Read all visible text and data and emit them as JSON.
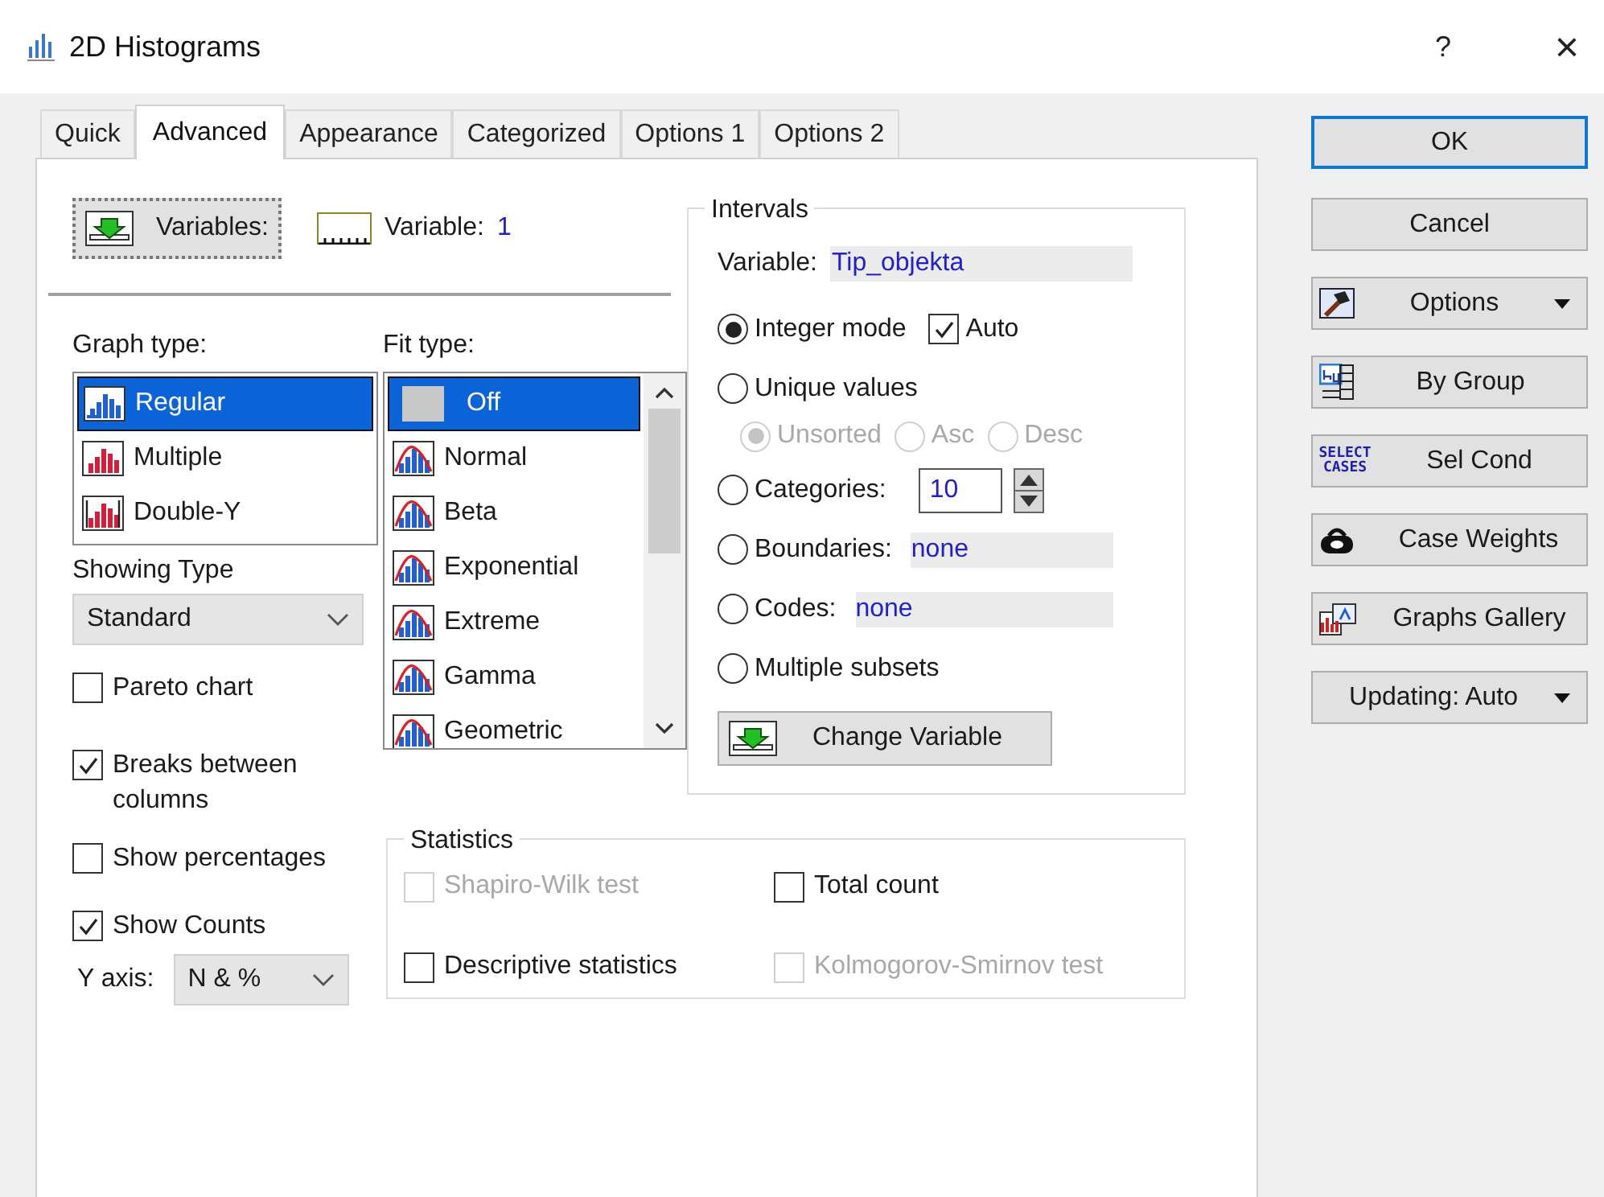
{
  "window": {
    "title": "2D Histograms",
    "help": "?",
    "close": "×"
  },
  "tabs": [
    {
      "label": "Quick",
      "selected": false
    },
    {
      "label": "Advanced",
      "selected": true
    },
    {
      "label": "Appearance",
      "selected": false
    },
    {
      "label": "Categorized",
      "selected": false
    },
    {
      "label": "Options 1",
      "selected": false
    },
    {
      "label": "Options 2",
      "selected": false
    }
  ],
  "variables_button": {
    "label": "Variables:"
  },
  "variable_summary": {
    "label": "Variable:",
    "value": "1"
  },
  "graph_type": {
    "label": "Graph type:",
    "items": [
      {
        "label": "Regular",
        "selected": true
      },
      {
        "label": "Multiple",
        "selected": false
      },
      {
        "label": "Double-Y",
        "selected": false
      }
    ]
  },
  "fit_type": {
    "label": "Fit type:",
    "items": [
      {
        "label": "Off",
        "selected": true
      },
      {
        "label": "Normal",
        "selected": false
      },
      {
        "label": "Beta",
        "selected": false
      },
      {
        "label": "Exponential",
        "selected": false
      },
      {
        "label": "Extreme",
        "selected": false
      },
      {
        "label": "Gamma",
        "selected": false
      },
      {
        "label": "Geometric",
        "selected": false
      }
    ]
  },
  "showing_type": {
    "label": "Showing Type",
    "value": "Standard"
  },
  "options": [
    {
      "label": "Pareto chart",
      "checked": false
    },
    {
      "label": "Breaks between columns",
      "checked": true
    },
    {
      "label": "Show percentages",
      "checked": false
    },
    {
      "label": "Show Counts",
      "checked": true
    }
  ],
  "y_axis": {
    "label": "Y axis:",
    "value": "N & %"
  },
  "intervals": {
    "title": "Intervals",
    "variable_label": "Variable:",
    "variable_value": "Tip_objekta",
    "modes": [
      {
        "kind": "integer",
        "label": "Integer mode",
        "selected": true,
        "auto": {
          "label": "Auto",
          "checked": true
        }
      },
      {
        "kind": "unique",
        "label": "Unique values",
        "selected": false,
        "sort": [
          {
            "label": "Unsorted",
            "selected": true
          },
          {
            "label": "Asc",
            "selected": false
          },
          {
            "label": "Desc",
            "selected": false
          }
        ]
      },
      {
        "kind": "spinner",
        "label": "Categories:",
        "selected": false,
        "value": "10"
      },
      {
        "kind": "field",
        "label": "Boundaries:",
        "selected": false,
        "value": "none"
      },
      {
        "kind": "field",
        "label": "Codes:",
        "selected": false,
        "value": "none"
      },
      {
        "kind": "plain",
        "label": "Multiple subsets",
        "selected": false
      }
    ],
    "change_button": "Change Variable"
  },
  "statistics": {
    "title": "Statistics",
    "items": [
      {
        "label": "Shapiro-Wilk test",
        "checked": false,
        "disabled": true
      },
      {
        "label": "Total count",
        "checked": false,
        "disabled": false
      },
      {
        "label": "Descriptive statistics",
        "checked": false,
        "disabled": false
      },
      {
        "label": "Kolmogorov-Smirnov test",
        "checked": false,
        "disabled": true
      }
    ]
  },
  "buttons": [
    {
      "kind": "default",
      "label": "OK"
    },
    {
      "kind": "plain",
      "label": "Cancel"
    },
    {
      "kind": "options",
      "label": "Options",
      "dropdown": true
    },
    {
      "kind": "group",
      "label": "By Group",
      "dropdown": false
    },
    {
      "kind": "select",
      "label": "Sel Cond",
      "icon_text": [
        "SELECT",
        "CASES"
      ],
      "dropdown": false
    },
    {
      "kind": "weights",
      "label": "Case Weights",
      "dropdown": false
    },
    {
      "kind": "gallery",
      "label": "Graphs Gallery",
      "dropdown": false
    },
    {
      "kind": "updating",
      "label": "Updating: Auto",
      "dropdown": true
    }
  ]
}
